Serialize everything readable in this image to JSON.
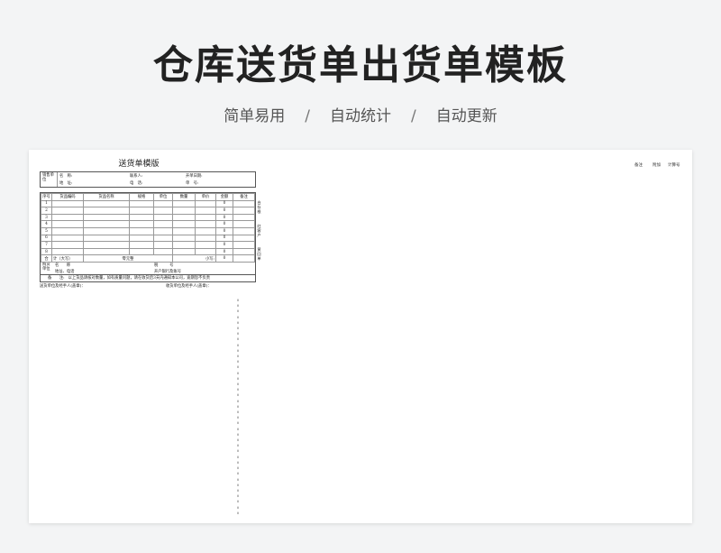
{
  "banner": {
    "title": "仓库送货单出货单模板",
    "features": [
      "简单易用",
      "自动统计",
      "自动更新"
    ],
    "separator": "/"
  },
  "sheet_header": [
    "备注",
    "附加",
    "计算号"
  ],
  "form": {
    "title": "送货单模版",
    "seller_label": "销售单位",
    "name_label": "名　称:",
    "contact_label": "联系人:",
    "date_label": "开单日期:",
    "address_label": "地　址:",
    "phone_label": "电　话:",
    "order_no_label": "单　号:",
    "columns": [
      "序号",
      "货品编码",
      "货品名称",
      "规格",
      "单位",
      "数量",
      "单价",
      "金额",
      "备注"
    ],
    "rows": [
      {
        "no": "1",
        "amount": "0"
      },
      {
        "no": "2",
        "amount": "0"
      },
      {
        "no": "3",
        "amount": "0"
      },
      {
        "no": "4",
        "amount": "0"
      },
      {
        "no": "5",
        "amount": "0"
      },
      {
        "no": "6",
        "amount": "0"
      },
      {
        "no": "7",
        "amount": "0"
      },
      {
        "no": "8",
        "amount": "0"
      }
    ],
    "side_notes": [
      "白存根",
      "红客户",
      "黄回单"
    ],
    "total_label": "合",
    "total_upper_label": "计（大写）",
    "total_upper_value": "零元整",
    "small_label": "小写:",
    "small_value": "0",
    "buyer_label": "购货单位",
    "buyer_name_label": "名　　称",
    "tax_label": "税　　　号",
    "buyer_address_label": "地址、电话",
    "bank_label": "开户银行及账号",
    "note_label": "备　　注:",
    "note_text": "以上货品请核对数量，如有质量问题，请在收货后3天内通知本公司，逾期恕不负责",
    "sender_sign": "送货单位及经手人(盖章)：",
    "receiver_sign": "收货单位及经手人(盖章)：",
    "zero": "0"
  }
}
